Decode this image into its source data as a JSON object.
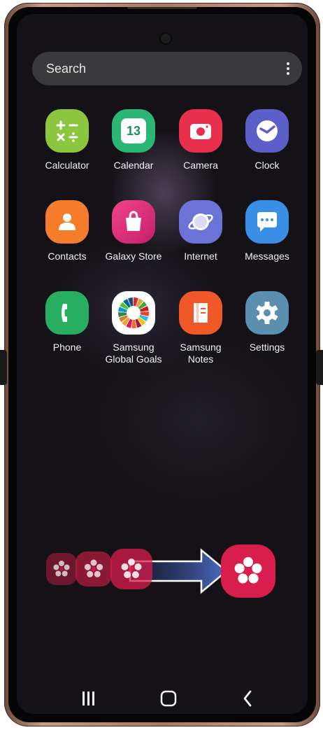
{
  "search": {
    "placeholder": "Search"
  },
  "apps": [
    {
      "label": "Calculator",
      "icon": "calculator-icon",
      "color": "#8cc63f"
    },
    {
      "label": "Calendar",
      "icon": "calendar-icon",
      "color": "#2bb673",
      "day": "13"
    },
    {
      "label": "Camera",
      "icon": "camera-icon",
      "color": "#e8304d"
    },
    {
      "label": "Clock",
      "icon": "clock-icon",
      "color": "#5b5fc7"
    },
    {
      "label": "Contacts",
      "icon": "contacts-icon",
      "color": "#f57c2a"
    },
    {
      "label": "Galaxy Store",
      "icon": "galaxy-store-icon",
      "color": "#e8306e"
    },
    {
      "label": "Internet",
      "icon": "internet-icon",
      "color": "#6b73d6"
    },
    {
      "label": "Messages",
      "icon": "messages-icon",
      "color": "#3a8ee6"
    },
    {
      "label": "Phone",
      "icon": "phone-icon",
      "color": "#27ae60"
    },
    {
      "label": "Samsung\nGlobal Goals",
      "icon": "global-goals-icon",
      "color": "#ffffff"
    },
    {
      "label": "Samsung\nNotes",
      "icon": "notes-icon",
      "color": "#f0582a"
    },
    {
      "label": "Settings",
      "icon": "settings-icon",
      "color": "#5a8fb0"
    }
  ],
  "flow": {
    "icon": "bixby-flower-icon",
    "color": "#d81e4c"
  },
  "nav": [
    "recent-apps-icon",
    "home-icon",
    "back-icon"
  ]
}
